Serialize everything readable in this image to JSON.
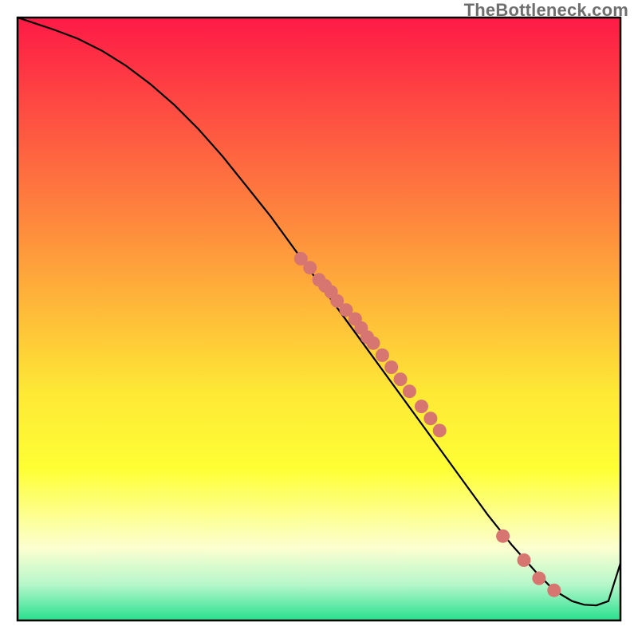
{
  "watermark": "TheBottleneck.com",
  "colors": {
    "gradient_top": "#fe1a46",
    "gradient_mid1": "#fe8c3d",
    "gradient_mid2": "#fee835",
    "gradient_mid3": "#feff35",
    "gradient_mid4": "#fcffd0",
    "gradient_mid5": "#b6f7ca",
    "gradient_bottom": "#28e08f",
    "plot_border": "#000000",
    "line_color": "#000000",
    "dot_color": "#d77570"
  },
  "chart_data": {
    "type": "line",
    "title": "",
    "xlabel": "",
    "ylabel": "",
    "xlim": [
      0,
      100
    ],
    "ylim": [
      0,
      100
    ],
    "series": [
      {
        "name": "curve",
        "x": [
          0,
          3,
          6,
          10,
          14,
          18,
          22,
          26,
          30,
          34,
          38,
          42,
          46,
          50,
          54,
          58,
          62,
          66,
          70,
          74,
          78,
          82,
          86,
          89,
          92,
          94,
          96,
          98,
          100
        ],
        "y": [
          100,
          99,
          98,
          96.5,
          94.5,
          92,
          89,
          85.5,
          81.5,
          77,
          72,
          67,
          61.5,
          56,
          50.5,
          45,
          39.5,
          34,
          28.5,
          23,
          17.5,
          12.5,
          8,
          5,
          3.2,
          2.6,
          2.5,
          3.2,
          9.5
        ]
      }
    ],
    "scatter_points": {
      "name": "dots",
      "x": [
        47,
        48.5,
        50,
        51,
        52,
        53,
        54.5,
        56,
        57,
        58,
        59,
        60.5,
        62,
        63.5,
        65,
        67,
        68.5,
        70,
        80.5,
        84,
        86.5,
        89
      ],
      "y": [
        60,
        58.5,
        56.5,
        55.5,
        54.5,
        53,
        51.5,
        50,
        48.5,
        47,
        46,
        44,
        42,
        40,
        38,
        35.5,
        33.5,
        31.5,
        14,
        10,
        7,
        5
      ]
    }
  }
}
